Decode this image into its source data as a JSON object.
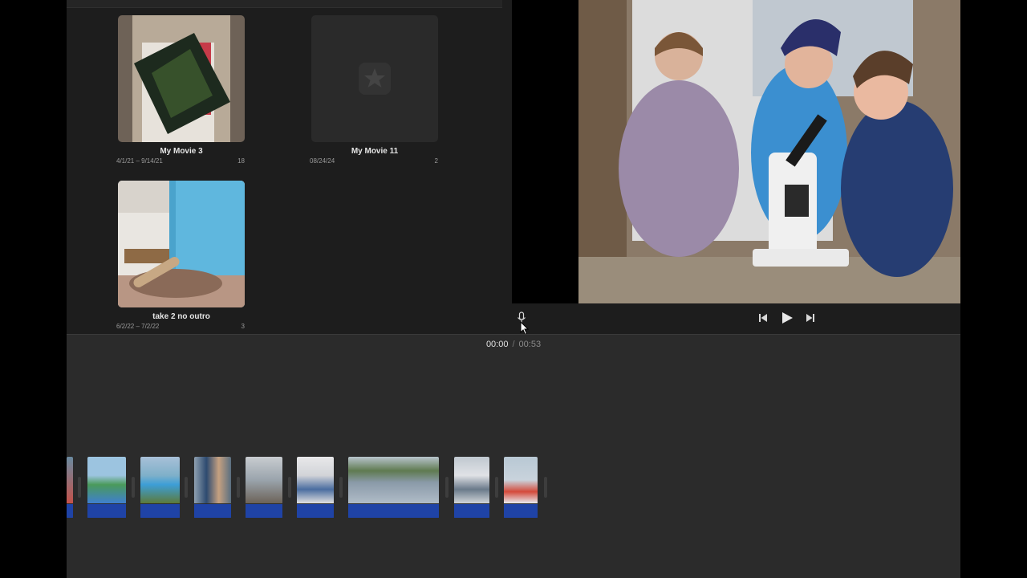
{
  "projects": [
    {
      "title": "My Movie 3",
      "dates": "4/1/21 – 9/14/21",
      "count": "18"
    },
    {
      "title": "My Movie 11",
      "dates": "08/24/24",
      "count": "2"
    },
    {
      "title": "take 2 no  outro",
      "dates": "6/2/22 – 7/2/22",
      "count": "3"
    }
  ],
  "timecode": {
    "current": "00:00",
    "separator": "/",
    "total": "00:53"
  },
  "colors": {
    "audio_bar": "#1f43a6",
    "background": "#1e1e1e",
    "timeline": "#2b2b2b"
  },
  "icons": {
    "microphone": "microphone-icon",
    "prev": "skip-back-icon",
    "play": "play-icon",
    "next": "skip-forward-icon",
    "star": "star-icon"
  }
}
